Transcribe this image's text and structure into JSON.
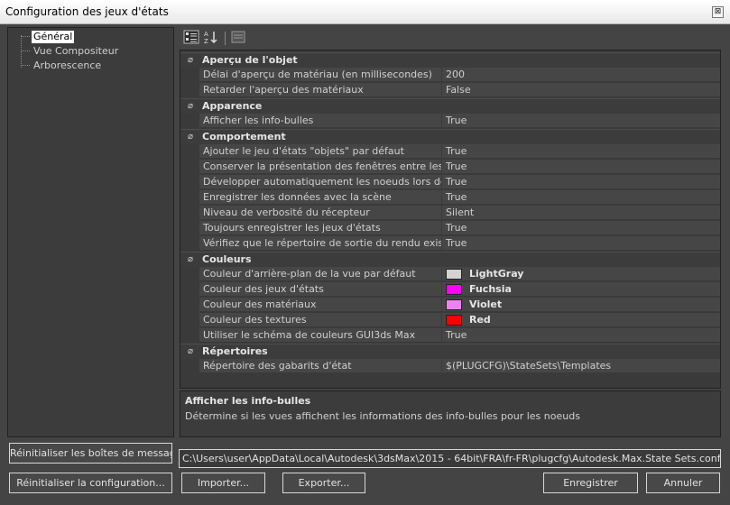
{
  "window": {
    "title": "Configuration des jeux d'états",
    "close_glyph": "⊠"
  },
  "tree": {
    "items": [
      "Général",
      "Vue Compositeur",
      "Arborescence"
    ]
  },
  "toolbar": {
    "icons": [
      "categorized-icon",
      "alphabetical-sort-icon",
      "property-pages-icon"
    ]
  },
  "grid": {
    "categories": [
      {
        "label": "Aperçu de l'objet",
        "props": [
          {
            "name": "Délai d'aperçu de matériau (en millisecondes)",
            "value": "200"
          },
          {
            "name": "Retarder l'aperçu des matériaux",
            "value": "False"
          }
        ]
      },
      {
        "label": "Apparence",
        "props": [
          {
            "name": "Afficher les info-bulles",
            "value": "True"
          }
        ]
      },
      {
        "label": "Comportement",
        "props": [
          {
            "name": "Ajouter le jeu d'états \"objets\" par défaut",
            "value": "True"
          },
          {
            "name": "Conserver la présentation des fenêtres entre les scènes",
            "value": "True"
          },
          {
            "name": "Développer automatiquement les noeuds lors de leur sélection",
            "value": "True"
          },
          {
            "name": "Enregistrer les données avec la scène",
            "value": "True"
          },
          {
            "name": "Niveau de verbosité du récepteur",
            "value": "Silent"
          },
          {
            "name": "Toujours enregistrer les jeux d'états",
            "value": "True"
          },
          {
            "name": "Vérifiez que le répertoire de sortie du rendu existe.",
            "value": "True"
          }
        ]
      },
      {
        "label": "Couleurs",
        "props": [
          {
            "name": "Couleur d'arrière-plan de la vue par défaut",
            "value": "LightGray",
            "color": "#d3d3d3"
          },
          {
            "name": "Couleur des jeux d'états",
            "value": "Fuchsia",
            "color": "#ff00ff"
          },
          {
            "name": "Couleur des matériaux",
            "value": "Violet",
            "color": "#ee82ee"
          },
          {
            "name": "Couleur des textures",
            "value": "Red",
            "color": "#ff0000"
          },
          {
            "name": "Utiliser le schéma de couleurs GUI3ds Max",
            "value": "True"
          }
        ]
      },
      {
        "label": "Répertoires",
        "props": [
          {
            "name": "Répertoire des gabarits d'état",
            "value": "$(PLUGCFG)\\StateSets\\Templates"
          }
        ]
      }
    ]
  },
  "description": {
    "title": "Afficher les info-bulles",
    "text": "Détermine si les vues affichent les informations des info-bulles pour les noeuds"
  },
  "buttons": {
    "reset_boxes": "Réinitialiser les boîtes de message",
    "reset_config": "Réinitialiser la configuration...",
    "import": "Importer...",
    "export": "Exporter...",
    "save": "Enregistrer",
    "cancel": "Annuler"
  },
  "config_path": "C:\\Users\\user\\AppData\\Local\\Autodesk\\3dsMax\\2015 - 64bit\\FRA\\fr-FR\\plugcfg\\Autodesk.Max.State Sets.config"
}
